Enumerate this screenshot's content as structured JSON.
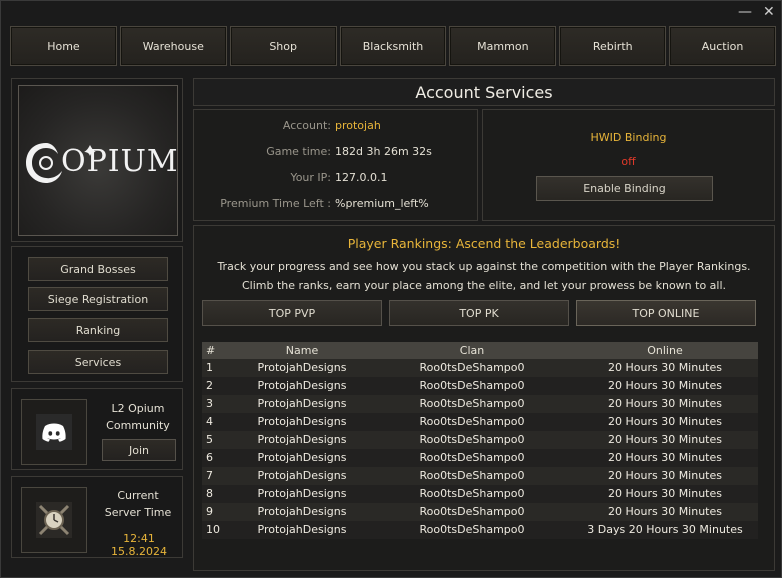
{
  "window": {
    "minimize_glyph": "—",
    "close_glyph": "✕"
  },
  "nav": [
    "Home",
    "Warehouse",
    "Shop",
    "Blacksmith",
    "Mammon",
    "Rebirth",
    "Auction"
  ],
  "logo": {
    "text": "OPIUM"
  },
  "sidebar": {
    "items": [
      "Grand Bosses",
      "Siege Registration",
      "Ranking",
      "Services"
    ]
  },
  "discord": {
    "icon": "discord-icon",
    "line1": "L2 Opium",
    "line2": "Community",
    "join_label": "Join"
  },
  "server_time": {
    "icon": "clock-icon",
    "line1": "Current",
    "line2": "Server Time",
    "value": "12:41 15.8.2024"
  },
  "header": {
    "title": "Account Services"
  },
  "account": {
    "account_label": "Account:",
    "account_value": "protojah",
    "gametime_label": "Game time:",
    "gametime_value": "182d 3h 26m 32s",
    "ip_label": "Your IP:",
    "ip_value": "127.0.0.1",
    "premium_label": "Premium Time Left :",
    "premium_value": "%premium_left%"
  },
  "hwid": {
    "title": "HWID Binding",
    "state": "off",
    "button_label": "Enable Binding"
  },
  "rankings": {
    "title": "Player Rankings: Ascend the Leaderboards!",
    "desc1": "Track your progress and see how you stack up against the competition with the Player Rankings.",
    "desc2": "Climb the ranks, earn your place among the elite, and let your prowess be known to all.",
    "tabs": [
      "TOP PVP",
      "TOP PK",
      "TOP ONLINE"
    ],
    "columns": [
      "#",
      "Name",
      "Clan",
      "Online"
    ],
    "rows": [
      [
        "1",
        "ProtojahDesigns",
        "Roo0tsDeShampo0",
        "20 Hours 30 Minutes"
      ],
      [
        "2",
        "ProtojahDesigns",
        "Roo0tsDeShampo0",
        "20 Hours 30 Minutes"
      ],
      [
        "3",
        "ProtojahDesigns",
        "Roo0tsDeShampo0",
        "20 Hours 30 Minutes"
      ],
      [
        "4",
        "ProtojahDesigns",
        "Roo0tsDeShampo0",
        "20 Hours 30 Minutes"
      ],
      [
        "5",
        "ProtojahDesigns",
        "Roo0tsDeShampo0",
        "20 Hours 30 Minutes"
      ],
      [
        "6",
        "ProtojahDesigns",
        "Roo0tsDeShampo0",
        "20 Hours 30 Minutes"
      ],
      [
        "7",
        "ProtojahDesigns",
        "Roo0tsDeShampo0",
        "20 Hours 30 Minutes"
      ],
      [
        "8",
        "ProtojahDesigns",
        "Roo0tsDeShampo0",
        "20 Hours 30 Minutes"
      ],
      [
        "9",
        "ProtojahDesigns",
        "Roo0tsDeShampo0",
        "20 Hours 30 Minutes"
      ],
      [
        "10",
        "ProtojahDesigns",
        "Roo0tsDeShampo0",
        "3 Days 20 Hours 30 Minutes"
      ]
    ]
  },
  "colors": {
    "gold": "#e8b53a",
    "red": "#e33a2a"
  }
}
